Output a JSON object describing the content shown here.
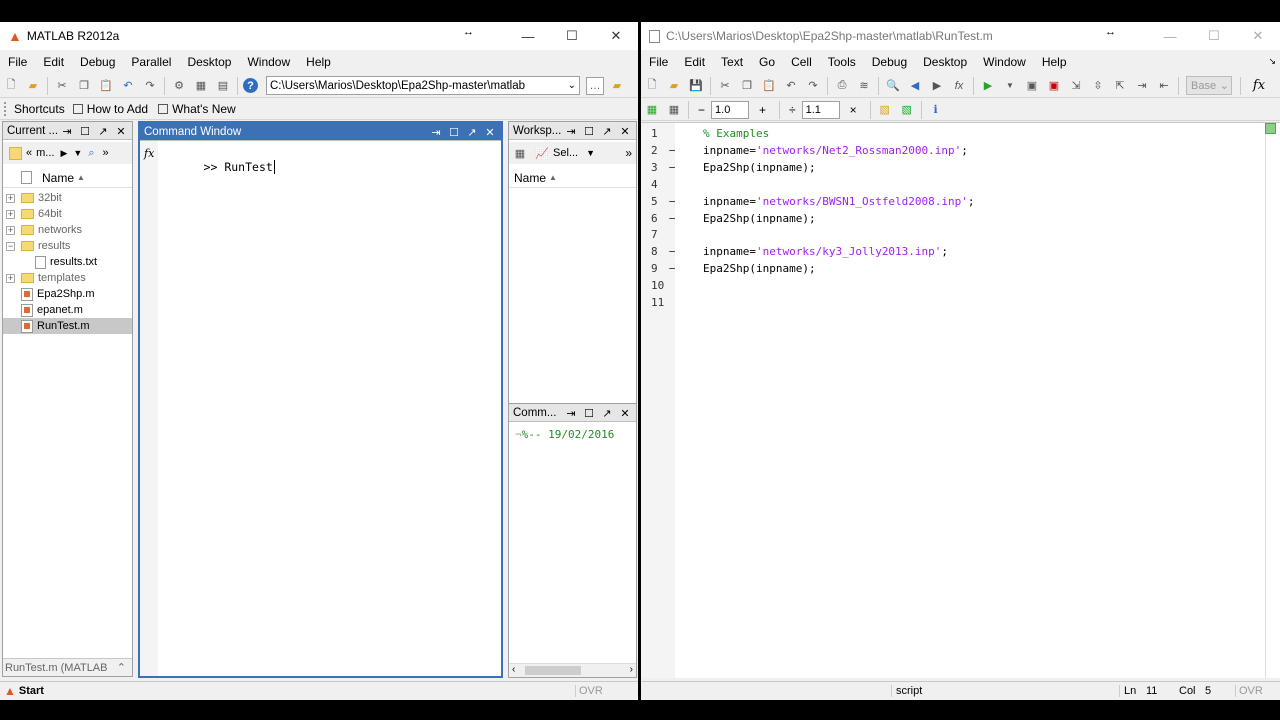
{
  "left_window": {
    "title": "MATLAB  R2012a",
    "menu": [
      "File",
      "Edit",
      "Debug",
      "Parallel",
      "Desktop",
      "Window",
      "Help"
    ],
    "path": "C:\\Users\\Marios\\Desktop\\Epa2Shp-master\\matlab",
    "shortcuts": {
      "shortcuts": "Shortcuts",
      "how_to_add": "How to Add",
      "whats_new": "What's New"
    },
    "current_folder": {
      "title": "Current ...",
      "nav_label": "m...",
      "column": "Name",
      "items": [
        {
          "name": "32bit",
          "type": "folder",
          "expand": "+"
        },
        {
          "name": "64bit",
          "type": "folder",
          "expand": "+"
        },
        {
          "name": "networks",
          "type": "folder",
          "expand": "+"
        },
        {
          "name": "results",
          "type": "folder",
          "expand": "−"
        },
        {
          "name": "results.txt",
          "type": "txt",
          "expand": ""
        },
        {
          "name": "templates",
          "type": "folder",
          "expand": "+"
        },
        {
          "name": "Epa2Shp.m",
          "type": "m",
          "expand": ""
        },
        {
          "name": "epanet.m",
          "type": "m",
          "expand": ""
        },
        {
          "name": "RunTest.m",
          "type": "m",
          "expand": ""
        }
      ],
      "footer": "RunTest.m (MATLAB"
    },
    "command_window": {
      "title": "Command Window",
      "prompt": ">> ",
      "command": "RunTest",
      "fx": "fx"
    },
    "workspace": {
      "title": "Worksp...",
      "select": "Sel...",
      "column": "Name"
    },
    "command_history": {
      "title": "Comm...",
      "entry": "%-- 19/02/2016"
    },
    "status": {
      "start": "Start",
      "ovr": "OVR"
    }
  },
  "right_window": {
    "title": "C:\\Users\\Marios\\Desktop\\Epa2Shp-master\\matlab\\RunTest.m",
    "menu": [
      "File",
      "Edit",
      "Text",
      "Go",
      "Cell",
      "Tools",
      "Debug",
      "Desktop",
      "Window",
      "Help"
    ],
    "base_label": "Base",
    "cell_toolbar": {
      "minus": "−",
      "val1": "1.0",
      "plus": "+",
      "div": "÷",
      "val2": "1.1",
      "times": "×"
    },
    "lines": [
      {
        "num": "1",
        "dash": "",
        "parts": [
          {
            "t": "% Examples",
            "c": "cmt"
          }
        ]
      },
      {
        "num": "2",
        "dash": "−",
        "parts": [
          {
            "t": "inpname=",
            "c": ""
          },
          {
            "t": "'networks/Net2_Rossman2000.inp'",
            "c": "str"
          },
          {
            "t": ";",
            "c": ""
          }
        ]
      },
      {
        "num": "3",
        "dash": "−",
        "parts": [
          {
            "t": "Epa2Shp(inpname);",
            "c": ""
          }
        ]
      },
      {
        "num": "4",
        "dash": "",
        "parts": []
      },
      {
        "num": "5",
        "dash": "−",
        "parts": [
          {
            "t": "inpname=",
            "c": ""
          },
          {
            "t": "'networks/BWSN1_Ostfeld2008.inp'",
            "c": "str"
          },
          {
            "t": ";",
            "c": ""
          }
        ]
      },
      {
        "num": "6",
        "dash": "−",
        "parts": [
          {
            "t": "Epa2Shp(inpname);",
            "c": ""
          }
        ]
      },
      {
        "num": "7",
        "dash": "",
        "parts": []
      },
      {
        "num": "8",
        "dash": "−",
        "parts": [
          {
            "t": "inpname=",
            "c": ""
          },
          {
            "t": "'networks/ky3_Jolly2013.inp'",
            "c": "str"
          },
          {
            "t": ";",
            "c": ""
          }
        ]
      },
      {
        "num": "9",
        "dash": "−",
        "parts": [
          {
            "t": "Epa2Shp(inpname);",
            "c": ""
          }
        ]
      },
      {
        "num": "10",
        "dash": "",
        "parts": []
      },
      {
        "num": "11",
        "dash": "",
        "parts": []
      }
    ],
    "status": {
      "mode": "script",
      "ln_label": "Ln",
      "ln": "11",
      "col_label": "Col",
      "col": "5",
      "ovr": "OVR"
    }
  },
  "colors": {
    "active_header": "#3d71b6",
    "string": "#a020f0",
    "comment": "#228b22"
  }
}
